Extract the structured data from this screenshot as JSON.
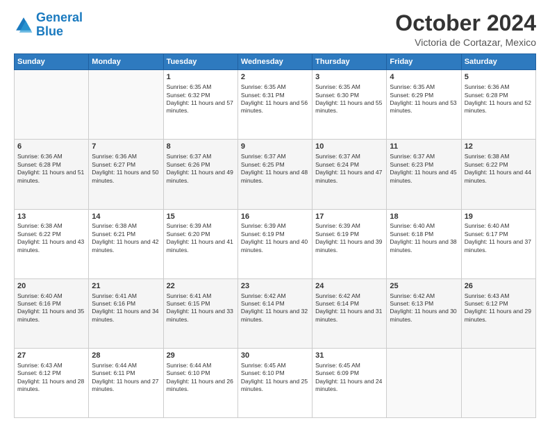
{
  "header": {
    "logo_line1": "General",
    "logo_line2": "Blue",
    "month": "October 2024",
    "location": "Victoria de Cortazar, Mexico"
  },
  "days_of_week": [
    "Sunday",
    "Monday",
    "Tuesday",
    "Wednesday",
    "Thursday",
    "Friday",
    "Saturday"
  ],
  "weeks": [
    [
      {
        "day": "",
        "info": ""
      },
      {
        "day": "",
        "info": ""
      },
      {
        "day": "1",
        "sunrise": "6:35 AM",
        "sunset": "6:32 PM",
        "daylight": "11 hours and 57 minutes."
      },
      {
        "day": "2",
        "sunrise": "6:35 AM",
        "sunset": "6:31 PM",
        "daylight": "11 hours and 56 minutes."
      },
      {
        "day": "3",
        "sunrise": "6:35 AM",
        "sunset": "6:30 PM",
        "daylight": "11 hours and 55 minutes."
      },
      {
        "day": "4",
        "sunrise": "6:35 AM",
        "sunset": "6:29 PM",
        "daylight": "11 hours and 53 minutes."
      },
      {
        "day": "5",
        "sunrise": "6:36 AM",
        "sunset": "6:28 PM",
        "daylight": "11 hours and 52 minutes."
      }
    ],
    [
      {
        "day": "6",
        "sunrise": "6:36 AM",
        "sunset": "6:28 PM",
        "daylight": "11 hours and 51 minutes."
      },
      {
        "day": "7",
        "sunrise": "6:36 AM",
        "sunset": "6:27 PM",
        "daylight": "11 hours and 50 minutes."
      },
      {
        "day": "8",
        "sunrise": "6:37 AM",
        "sunset": "6:26 PM",
        "daylight": "11 hours and 49 minutes."
      },
      {
        "day": "9",
        "sunrise": "6:37 AM",
        "sunset": "6:25 PM",
        "daylight": "11 hours and 48 minutes."
      },
      {
        "day": "10",
        "sunrise": "6:37 AM",
        "sunset": "6:24 PM",
        "daylight": "11 hours and 47 minutes."
      },
      {
        "day": "11",
        "sunrise": "6:37 AM",
        "sunset": "6:23 PM",
        "daylight": "11 hours and 45 minutes."
      },
      {
        "day": "12",
        "sunrise": "6:38 AM",
        "sunset": "6:22 PM",
        "daylight": "11 hours and 44 minutes."
      }
    ],
    [
      {
        "day": "13",
        "sunrise": "6:38 AM",
        "sunset": "6:22 PM",
        "daylight": "11 hours and 43 minutes."
      },
      {
        "day": "14",
        "sunrise": "6:38 AM",
        "sunset": "6:21 PM",
        "daylight": "11 hours and 42 minutes."
      },
      {
        "day": "15",
        "sunrise": "6:39 AM",
        "sunset": "6:20 PM",
        "daylight": "11 hours and 41 minutes."
      },
      {
        "day": "16",
        "sunrise": "6:39 AM",
        "sunset": "6:19 PM",
        "daylight": "11 hours and 40 minutes."
      },
      {
        "day": "17",
        "sunrise": "6:39 AM",
        "sunset": "6:19 PM",
        "daylight": "11 hours and 39 minutes."
      },
      {
        "day": "18",
        "sunrise": "6:40 AM",
        "sunset": "6:18 PM",
        "daylight": "11 hours and 38 minutes."
      },
      {
        "day": "19",
        "sunrise": "6:40 AM",
        "sunset": "6:17 PM",
        "daylight": "11 hours and 37 minutes."
      }
    ],
    [
      {
        "day": "20",
        "sunrise": "6:40 AM",
        "sunset": "6:16 PM",
        "daylight": "11 hours and 35 minutes."
      },
      {
        "day": "21",
        "sunrise": "6:41 AM",
        "sunset": "6:16 PM",
        "daylight": "11 hours and 34 minutes."
      },
      {
        "day": "22",
        "sunrise": "6:41 AM",
        "sunset": "6:15 PM",
        "daylight": "11 hours and 33 minutes."
      },
      {
        "day": "23",
        "sunrise": "6:42 AM",
        "sunset": "6:14 PM",
        "daylight": "11 hours and 32 minutes."
      },
      {
        "day": "24",
        "sunrise": "6:42 AM",
        "sunset": "6:14 PM",
        "daylight": "11 hours and 31 minutes."
      },
      {
        "day": "25",
        "sunrise": "6:42 AM",
        "sunset": "6:13 PM",
        "daylight": "11 hours and 30 minutes."
      },
      {
        "day": "26",
        "sunrise": "6:43 AM",
        "sunset": "6:12 PM",
        "daylight": "11 hours and 29 minutes."
      }
    ],
    [
      {
        "day": "27",
        "sunrise": "6:43 AM",
        "sunset": "6:12 PM",
        "daylight": "11 hours and 28 minutes."
      },
      {
        "day": "28",
        "sunrise": "6:44 AM",
        "sunset": "6:11 PM",
        "daylight": "11 hours and 27 minutes."
      },
      {
        "day": "29",
        "sunrise": "6:44 AM",
        "sunset": "6:10 PM",
        "daylight": "11 hours and 26 minutes."
      },
      {
        "day": "30",
        "sunrise": "6:45 AM",
        "sunset": "6:10 PM",
        "daylight": "11 hours and 25 minutes."
      },
      {
        "day": "31",
        "sunrise": "6:45 AM",
        "sunset": "6:09 PM",
        "daylight": "11 hours and 24 minutes."
      },
      {
        "day": "",
        "info": ""
      },
      {
        "day": "",
        "info": ""
      }
    ]
  ],
  "labels": {
    "sunrise_prefix": "Sunrise: ",
    "sunset_prefix": "Sunset: ",
    "daylight_prefix": "Daylight: "
  }
}
